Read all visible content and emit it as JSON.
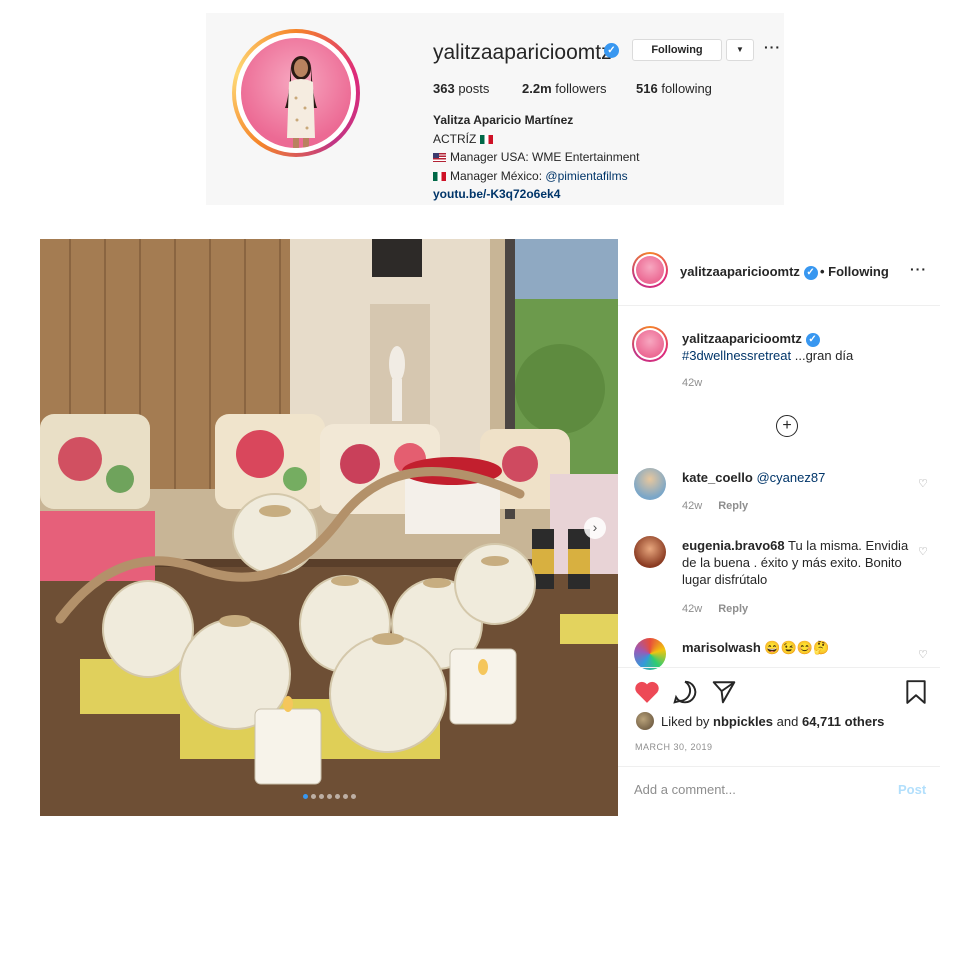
{
  "profile": {
    "username": "yalitzaaparicioomtz",
    "following_button": "Following",
    "posts_count": "363",
    "posts_label": "posts",
    "followers_count": "2.2m",
    "followers_label": "followers",
    "following_count": "516",
    "following_label": "following",
    "full_name": "Yalitza Aparicio Martínez",
    "bio_line1": "ACTRÍZ",
    "bio_line2": "Manager USA: WME Entertainment",
    "bio_line3_prefix": "Manager México:",
    "bio_line3_mention": "@pimientafilms",
    "link": "youtu.be/-K3q72o6ek4"
  },
  "post": {
    "header_username": "yalitzaaparicioomtz",
    "header_following": "• Following",
    "caption_username": "yalitzaaparicioomtz",
    "caption_hashtag": "#3dwellnessretreat",
    "caption_text": " ...gran día",
    "caption_age": "42w",
    "comments": [
      {
        "user": "kate_coello",
        "text": "@cyanez87",
        "age": "42w",
        "reply": "Reply"
      },
      {
        "user": "eugenia.bravo68",
        "text": "Tu la misma. Envidia de la buena . éxito y más exito. Bonito lugar disfrútalo",
        "age": "42w",
        "reply": "Reply"
      },
      {
        "user": "marisolwash",
        "text": "😄😉😊🤔"
      }
    ],
    "liked_by_prefix": "Liked by",
    "liked_by_user": "nbpickles",
    "liked_by_and": "and",
    "liked_by_others": "64,711 others",
    "date": "MARCH 30, 2019",
    "add_comment_placeholder": "Add a comment...",
    "post_button": "Post",
    "carousel_pages": 7,
    "carousel_current": 1
  },
  "colors": {
    "verified_blue": "#3897f0",
    "like_red": "#ed4956",
    "link_navy": "#003569"
  },
  "icons": [
    "verified-badge-icon",
    "more-options-icon",
    "chevron-down-icon",
    "plus-circle-icon",
    "heart-icon",
    "comment-icon",
    "share-icon",
    "bookmark-icon",
    "carousel-next-icon"
  ]
}
